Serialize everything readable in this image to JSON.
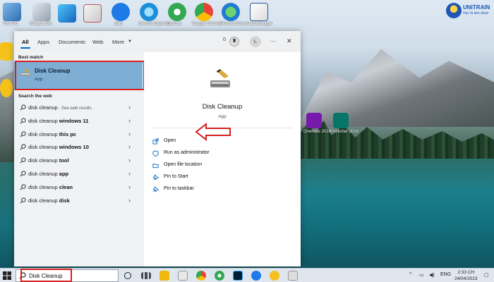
{
  "desktop": {
    "labels": [
      "This PC",
      "Recycle Bin",
      "Microsoft Edge",
      "Zalo",
      "Internet Explorer",
      "CocCoc",
      "Google Chrome",
      "Internet Download Manager",
      "Word",
      "OneNote 2016",
      "Publisher 2016"
    ],
    "brand": {
      "name": "UNITRAIN",
      "tagline": "Học là làm được"
    }
  },
  "search_panel": {
    "tabs": [
      "All",
      "Apps",
      "Documents",
      "Web",
      "More"
    ],
    "active_tab": "All",
    "reward_points": "0",
    "user_initial": "L",
    "more_menu": "···",
    "close": "✕",
    "best_match_label": "Best match",
    "best_match": {
      "title": "Disk Cleanup",
      "subtitle": "App"
    },
    "search_web_label": "Search the web",
    "web_results": [
      {
        "query": "disk cleanup",
        "bold": "",
        "suffix": " - See web results"
      },
      {
        "query": "disk cleanup ",
        "bold": "windows 11",
        "suffix": ""
      },
      {
        "query": "disk cleanup ",
        "bold": "this pc",
        "suffix": ""
      },
      {
        "query": "disk cleanup ",
        "bold": "windows 10",
        "suffix": ""
      },
      {
        "query": "disk cleanup ",
        "bold": "tool",
        "suffix": ""
      },
      {
        "query": "disk cleanup ",
        "bold": "app",
        "suffix": ""
      },
      {
        "query": "disk cleanup ",
        "bold": "clean",
        "suffix": ""
      },
      {
        "query": "disk cleanup ",
        "bold": "disk",
        "suffix": ""
      }
    ],
    "detail": {
      "title": "Disk Cleanup",
      "subtitle": "App",
      "actions": [
        "Open",
        "Run as administrator",
        "Open file location",
        "Pin to Start",
        "Pin to taskbar"
      ]
    }
  },
  "taskbar": {
    "search_value": "Disk Cleanup",
    "tray": {
      "chevron": "^",
      "language": "ENG"
    },
    "clock": {
      "time": "2:33 CH",
      "date": "24/04/2023"
    }
  },
  "colors": {
    "accent": "#0067c0",
    "highlight": "#d81e1e",
    "best_match_bg": "#7eaed3"
  }
}
